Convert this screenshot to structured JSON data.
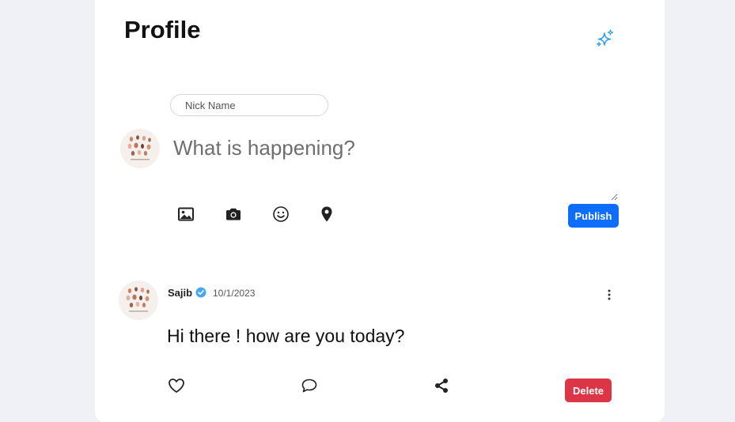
{
  "page": {
    "title": "Profile"
  },
  "composer": {
    "nickname_placeholder": "Nick Name",
    "post_placeholder": "What is happening?",
    "tools": [
      "image-icon",
      "camera-icon",
      "emoji-icon",
      "location-icon"
    ],
    "publish_label": "Publish"
  },
  "post": {
    "author": "Sajib",
    "verified": true,
    "date": "10/1/2023",
    "text": "Hi there ! how are you today?",
    "actions": [
      "heart-icon",
      "comment-icon",
      "share-icon"
    ],
    "delete_label": "Delete"
  },
  "colors": {
    "background": "#f0f1f6",
    "card": "#ffffff",
    "primary": "#0d6efd",
    "danger": "#dc3545",
    "accent": "#1d9bf0",
    "verified": "#4aa8f0"
  }
}
